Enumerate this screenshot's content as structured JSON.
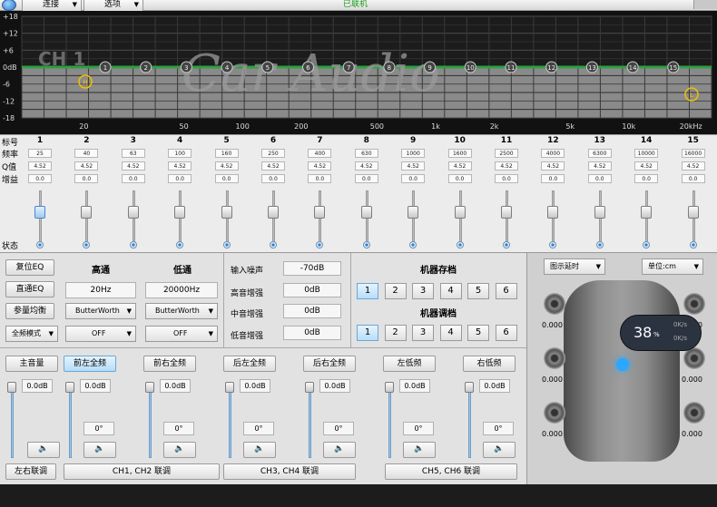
{
  "window": {
    "connect_menu": "连接",
    "options_menu": "选项",
    "status": "已联机"
  },
  "graph": {
    "channel": "CH 1",
    "watermark": "Car Audio",
    "db_labels": [
      "+18",
      "+12",
      "+6",
      "0dB",
      "-6",
      "-12",
      "-18"
    ],
    "freq_labels": [
      "20",
      "50",
      "100",
      "200",
      "500",
      "1k",
      "2k",
      "5k",
      "10k",
      "20kHz"
    ],
    "markers": [
      "1",
      "2",
      "3",
      "4",
      "5",
      "6",
      "7",
      "8",
      "9",
      "10",
      "11",
      "12",
      "13",
      "14",
      "15"
    ],
    "highpass_marker": "H",
    "lowpass_marker": "L",
    "colors": {
      "curve": "#2ea043",
      "grid": "#3a3a3a",
      "marker": "#f0c000"
    }
  },
  "eq": {
    "labels": {
      "index": "标号",
      "freq": "频率",
      "q": "Q值",
      "gain": "增益",
      "state": "状态"
    },
    "bands": [
      {
        "n": "1",
        "freq": "25",
        "q": "4.52",
        "gain": "0.0"
      },
      {
        "n": "2",
        "freq": "40",
        "q": "4.52",
        "gain": "0.0"
      },
      {
        "n": "3",
        "freq": "63",
        "q": "4.52",
        "gain": "0.0"
      },
      {
        "n": "4",
        "freq": "100",
        "q": "4.52",
        "gain": "0.0"
      },
      {
        "n": "5",
        "freq": "160",
        "q": "4.52",
        "gain": "0.0"
      },
      {
        "n": "6",
        "freq": "250",
        "q": "4.52",
        "gain": "0.0"
      },
      {
        "n": "7",
        "freq": "400",
        "q": "4.52",
        "gain": "0.0"
      },
      {
        "n": "8",
        "freq": "630",
        "q": "4.52",
        "gain": "0.0"
      },
      {
        "n": "9",
        "freq": "1000",
        "q": "4.52",
        "gain": "0.0"
      },
      {
        "n": "10",
        "freq": "1600",
        "q": "4.52",
        "gain": "0.0"
      },
      {
        "n": "11",
        "freq": "2500",
        "q": "4.52",
        "gain": "0.0"
      },
      {
        "n": "12",
        "freq": "4000",
        "q": "4.52",
        "gain": "0.0"
      },
      {
        "n": "13",
        "freq": "6300",
        "q": "4.52",
        "gain": "0.0"
      },
      {
        "n": "14",
        "freq": "10000",
        "q": "4.52",
        "gain": "0.0"
      },
      {
        "n": "15",
        "freq": "16000",
        "q": "4.52",
        "gain": "0.0"
      }
    ]
  },
  "controls": {
    "reset_eq": "复位EQ",
    "flat_eq": "直通EQ",
    "param_eq": "参量均衡",
    "full_mode": "全频模式",
    "highpass": "高通",
    "lowpass": "低通",
    "hp_freq": "20Hz",
    "lp_freq": "20000Hz",
    "hp_type": "ButterWorth",
    "lp_type": "ButterWorth",
    "hp_slope": "OFF",
    "lp_slope": "OFF"
  },
  "levels": {
    "input_noise": "输入噪声",
    "input_noise_val": "-70dB",
    "treble": "高音增强",
    "treble_val": "0dB",
    "mid": "中音增强",
    "mid_val": "0dB",
    "bass": "低音增强",
    "bass_val": "0dB"
  },
  "presets": {
    "store_title": "机器存档",
    "load_title": "机器调档",
    "numbers": [
      "1",
      "2",
      "3",
      "4",
      "5",
      "6"
    ]
  },
  "mixer": {
    "channels": [
      {
        "label": "主音量",
        "val": "0.0dB",
        "delay": ""
      },
      {
        "label": "前左全频",
        "val": "0.0dB",
        "delay": "0°"
      },
      {
        "label": "前右全频",
        "val": "0.0dB",
        "delay": "0°"
      },
      {
        "label": "后左全频",
        "val": "0.0dB",
        "delay": "0°"
      },
      {
        "label": "后右全频",
        "val": "0.0dB",
        "delay": "0°"
      },
      {
        "label": "左低频",
        "val": "0.0dB",
        "delay": "0°"
      },
      {
        "label": "右低频",
        "val": "0.0dB",
        "delay": "0°"
      }
    ],
    "link_lr": "左右联调",
    "link_12": "CH1, CH2 联调",
    "link_34": "CH3, CH4 联调",
    "link_56": "CH5, CH6 联调"
  },
  "delay": {
    "mode": "图示延时",
    "unit": "单位:cm",
    "values": [
      "0.000",
      "0.000",
      "0.000",
      "0.000",
      "0.000",
      "0.000",
      "0.000",
      "0.000"
    ],
    "gauge_pct": "38",
    "gauge_unit": "%",
    "rate1": "0K/s",
    "rate2": "0K/s"
  }
}
